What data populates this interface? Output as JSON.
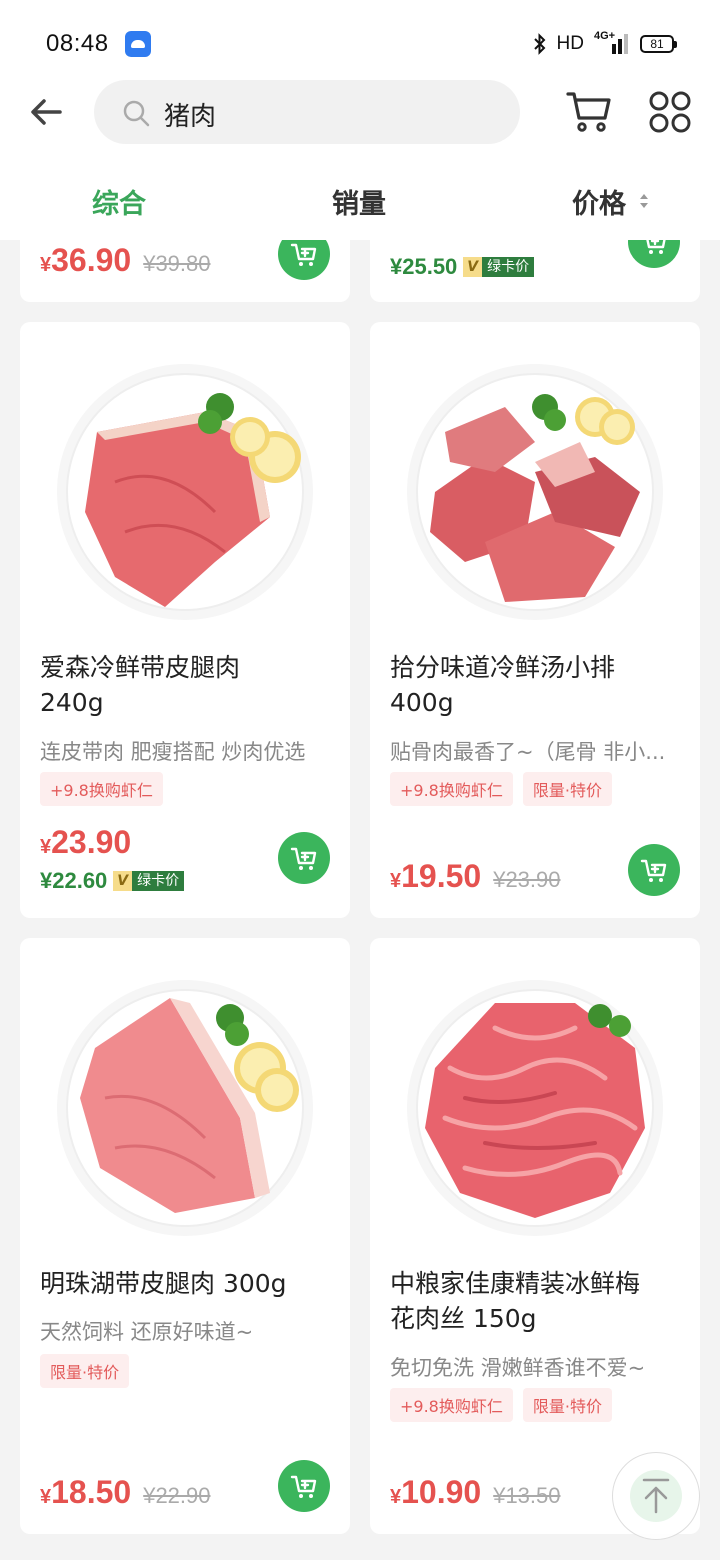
{
  "status_bar": {
    "time": "08:48",
    "network_type": "HD",
    "signal_gen": "4G+",
    "battery": "81"
  },
  "search": {
    "query": "猪肉"
  },
  "icons": {
    "back": "back-arrow-icon",
    "search": "search-icon",
    "cart": "cart-icon",
    "menu": "grid-menu-icon",
    "add_cart": "add-cart-icon",
    "back_to_top": "back-to-top-icon"
  },
  "colors": {
    "accent_green": "#3aa65a",
    "price_red": "#e5524f",
    "cart_button": "#3bb55c"
  },
  "tabs": [
    {
      "label": "综合",
      "active": true
    },
    {
      "label": "销量",
      "active": false
    },
    {
      "label": "价格",
      "active": false
    }
  ],
  "currency": "¥",
  "top_row": [
    {
      "price": "36.90",
      "old_price": "¥39.80"
    },
    {
      "member_price": "¥25.50",
      "member_v": "V",
      "member_label": "绿卡价"
    }
  ],
  "products": [
    {
      "title_line1": "爱森冷鲜带皮腿肉",
      "title_line2": "240g",
      "subtitle": "连皮带肉 肥瘦搭配 炒肉优选",
      "tags": [
        "+9.8换购虾仁"
      ],
      "price": "23.90",
      "member_price": "¥22.60",
      "member_v": "V",
      "member_label": "绿卡价"
    },
    {
      "title_line1": "拾分味道冷鲜汤小排",
      "title_line2": "400g",
      "subtitle": "贴骨肉最香了~（尾骨 非小...",
      "tags": [
        "+9.8换购虾仁",
        "限量·特价"
      ],
      "price": "19.50",
      "old_price": "¥23.90"
    },
    {
      "title_line1": "明珠湖带皮腿肉 300g",
      "subtitle": "天然饲料 还原好味道~",
      "tags": [
        "限量·特价"
      ],
      "price": "18.50",
      "old_price": "¥22.90"
    },
    {
      "title_line1": "中粮家佳康精装冰鲜梅",
      "title_line2": "花肉丝 150g",
      "subtitle": "免切免洗 滑嫩鲜香谁不爱~",
      "tags": [
        "+9.8换购虾仁",
        "限量·特价"
      ],
      "price": "10.90",
      "old_price": "¥13.50"
    }
  ]
}
